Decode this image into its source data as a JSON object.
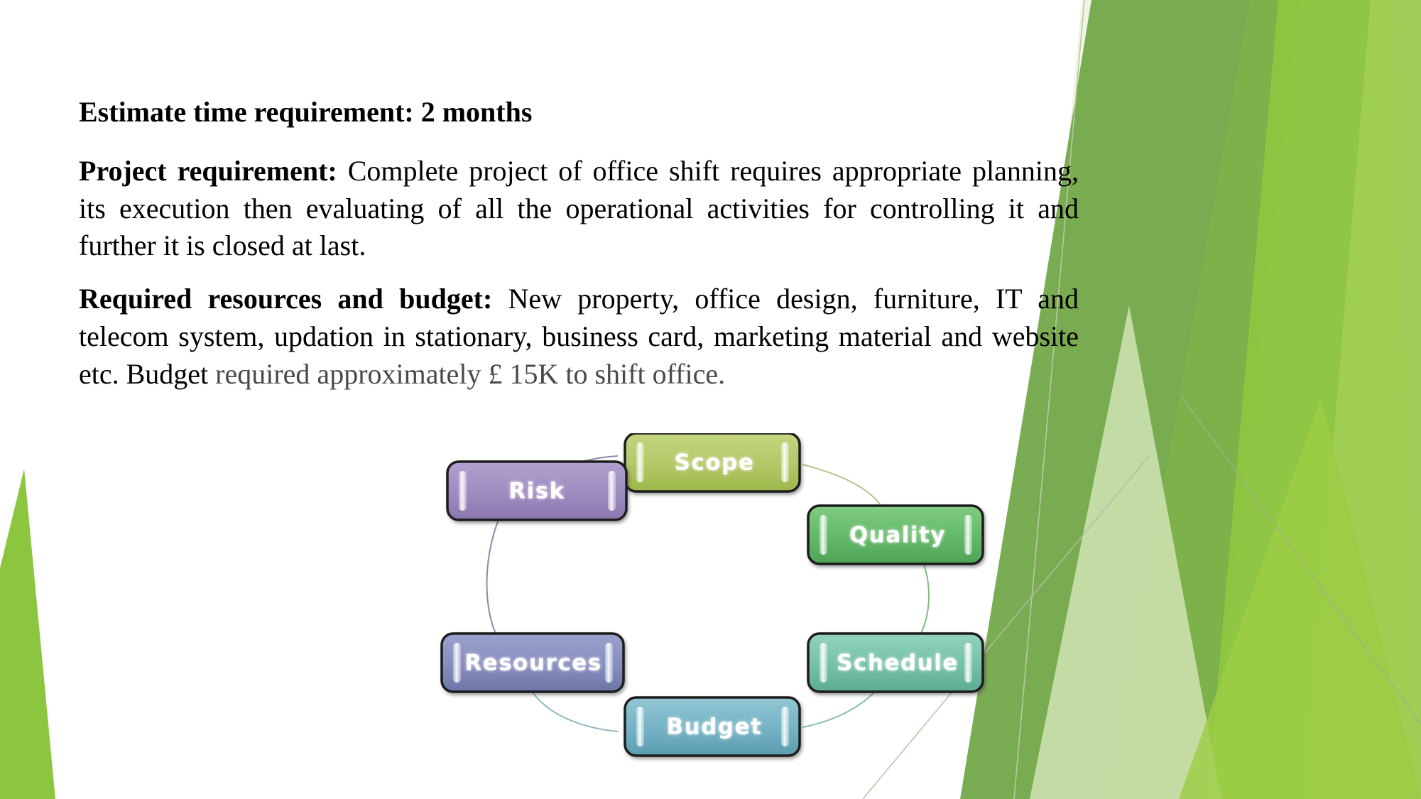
{
  "slide": {
    "background_color": "#ffffff",
    "accent_color": "#8CC63E"
  },
  "content": {
    "estimate_line": {
      "bold_text": "Estimate time requirement: 2 months"
    },
    "project_requirement": {
      "label": "Project requirement:",
      "body": " Complete project of office shift requires appropriate planning, its execution then evaluating of all the operational activities for controlling it and further it is closed at last."
    },
    "required_resources": {
      "label": "Required resources and budget:",
      "body_black": " New property, office design, furniture, IT and telecom system, updation in stationary, business card, marketing material and website etc. Budget",
      "body_muted": " required approximately £ 15K to shift office."
    }
  },
  "diagram": {
    "title": "project-constraints-cycle",
    "nodes": [
      {
        "id": "scope",
        "label": "Scope",
        "fill_light": "#bccf72",
        "fill_dark": "#9eb84a",
        "text_color": "#ffffff"
      },
      {
        "id": "quality",
        "label": "Quality",
        "fill_light": "#76c478",
        "fill_dark": "#4faa55",
        "text_color": "#ffffff"
      },
      {
        "id": "schedule",
        "label": "Schedule",
        "fill_light": "#86c9b4",
        "fill_dark": "#5cae97",
        "text_color": "#ffffff"
      },
      {
        "id": "budget",
        "label": "Budget",
        "fill_light": "#87bccb",
        "fill_dark": "#5c9fb2",
        "text_color": "#ffffff"
      },
      {
        "id": "resources",
        "label": "Resources",
        "fill_light": "#8e95c4",
        "fill_dark": "#6e77ac",
        "text_color": "#ffffff"
      },
      {
        "id": "risk",
        "label": "Risk",
        "fill_light": "#a694c4",
        "fill_dark": "#8e79b0",
        "text_color": "#ffffff"
      }
    ],
    "connectors": [
      {
        "from": "risk",
        "to": "scope",
        "color": "#8b86a8"
      },
      {
        "from": "scope",
        "to": "quality",
        "color": "#b9bf86"
      },
      {
        "from": "quality",
        "to": "schedule",
        "color": "#7fbd86"
      },
      {
        "from": "schedule",
        "to": "budget",
        "color": "#86bfb4"
      },
      {
        "from": "budget",
        "to": "resources",
        "color": "#8fb8c0"
      },
      {
        "from": "resources",
        "to": "risk",
        "color": "#8b8aa8"
      }
    ]
  },
  "decoration": {
    "left_spike_color": "#8CC63E",
    "right_shapes": [
      {
        "name": "dark-green-wedge",
        "color": "#6fa544"
      },
      {
        "name": "mid-green-wedge",
        "color": "#7eb248"
      },
      {
        "name": "bright-green-wedge",
        "color": "#8fc63f"
      },
      {
        "name": "light-green-wedge",
        "color": "#a3cf56"
      },
      {
        "name": "pale-green-wedge",
        "color": "#cfe4a5"
      },
      {
        "name": "faint-green-wedge",
        "color": "#e8f2d4"
      }
    ]
  }
}
